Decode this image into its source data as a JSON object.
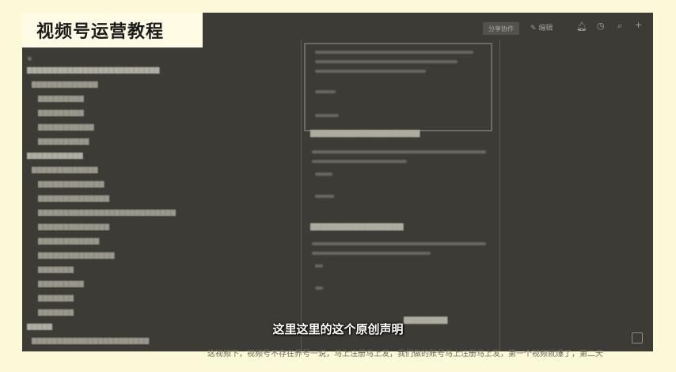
{
  "overlay_title": "视频号运营教程",
  "topbar": {
    "share_button": "分享协作",
    "edit_label": "编辑",
    "icons": [
      "edit-icon",
      "bell-icon",
      "clock-icon",
      "search-icon",
      "plus-icon"
    ]
  },
  "subtitle": "这里这里的这个原创声明",
  "bottom_caption": "这视频下，视频号不存在养号一说，马上注册马上发，我们做的账号马上注册马上发，第一个视频就爆了，第二天"
}
